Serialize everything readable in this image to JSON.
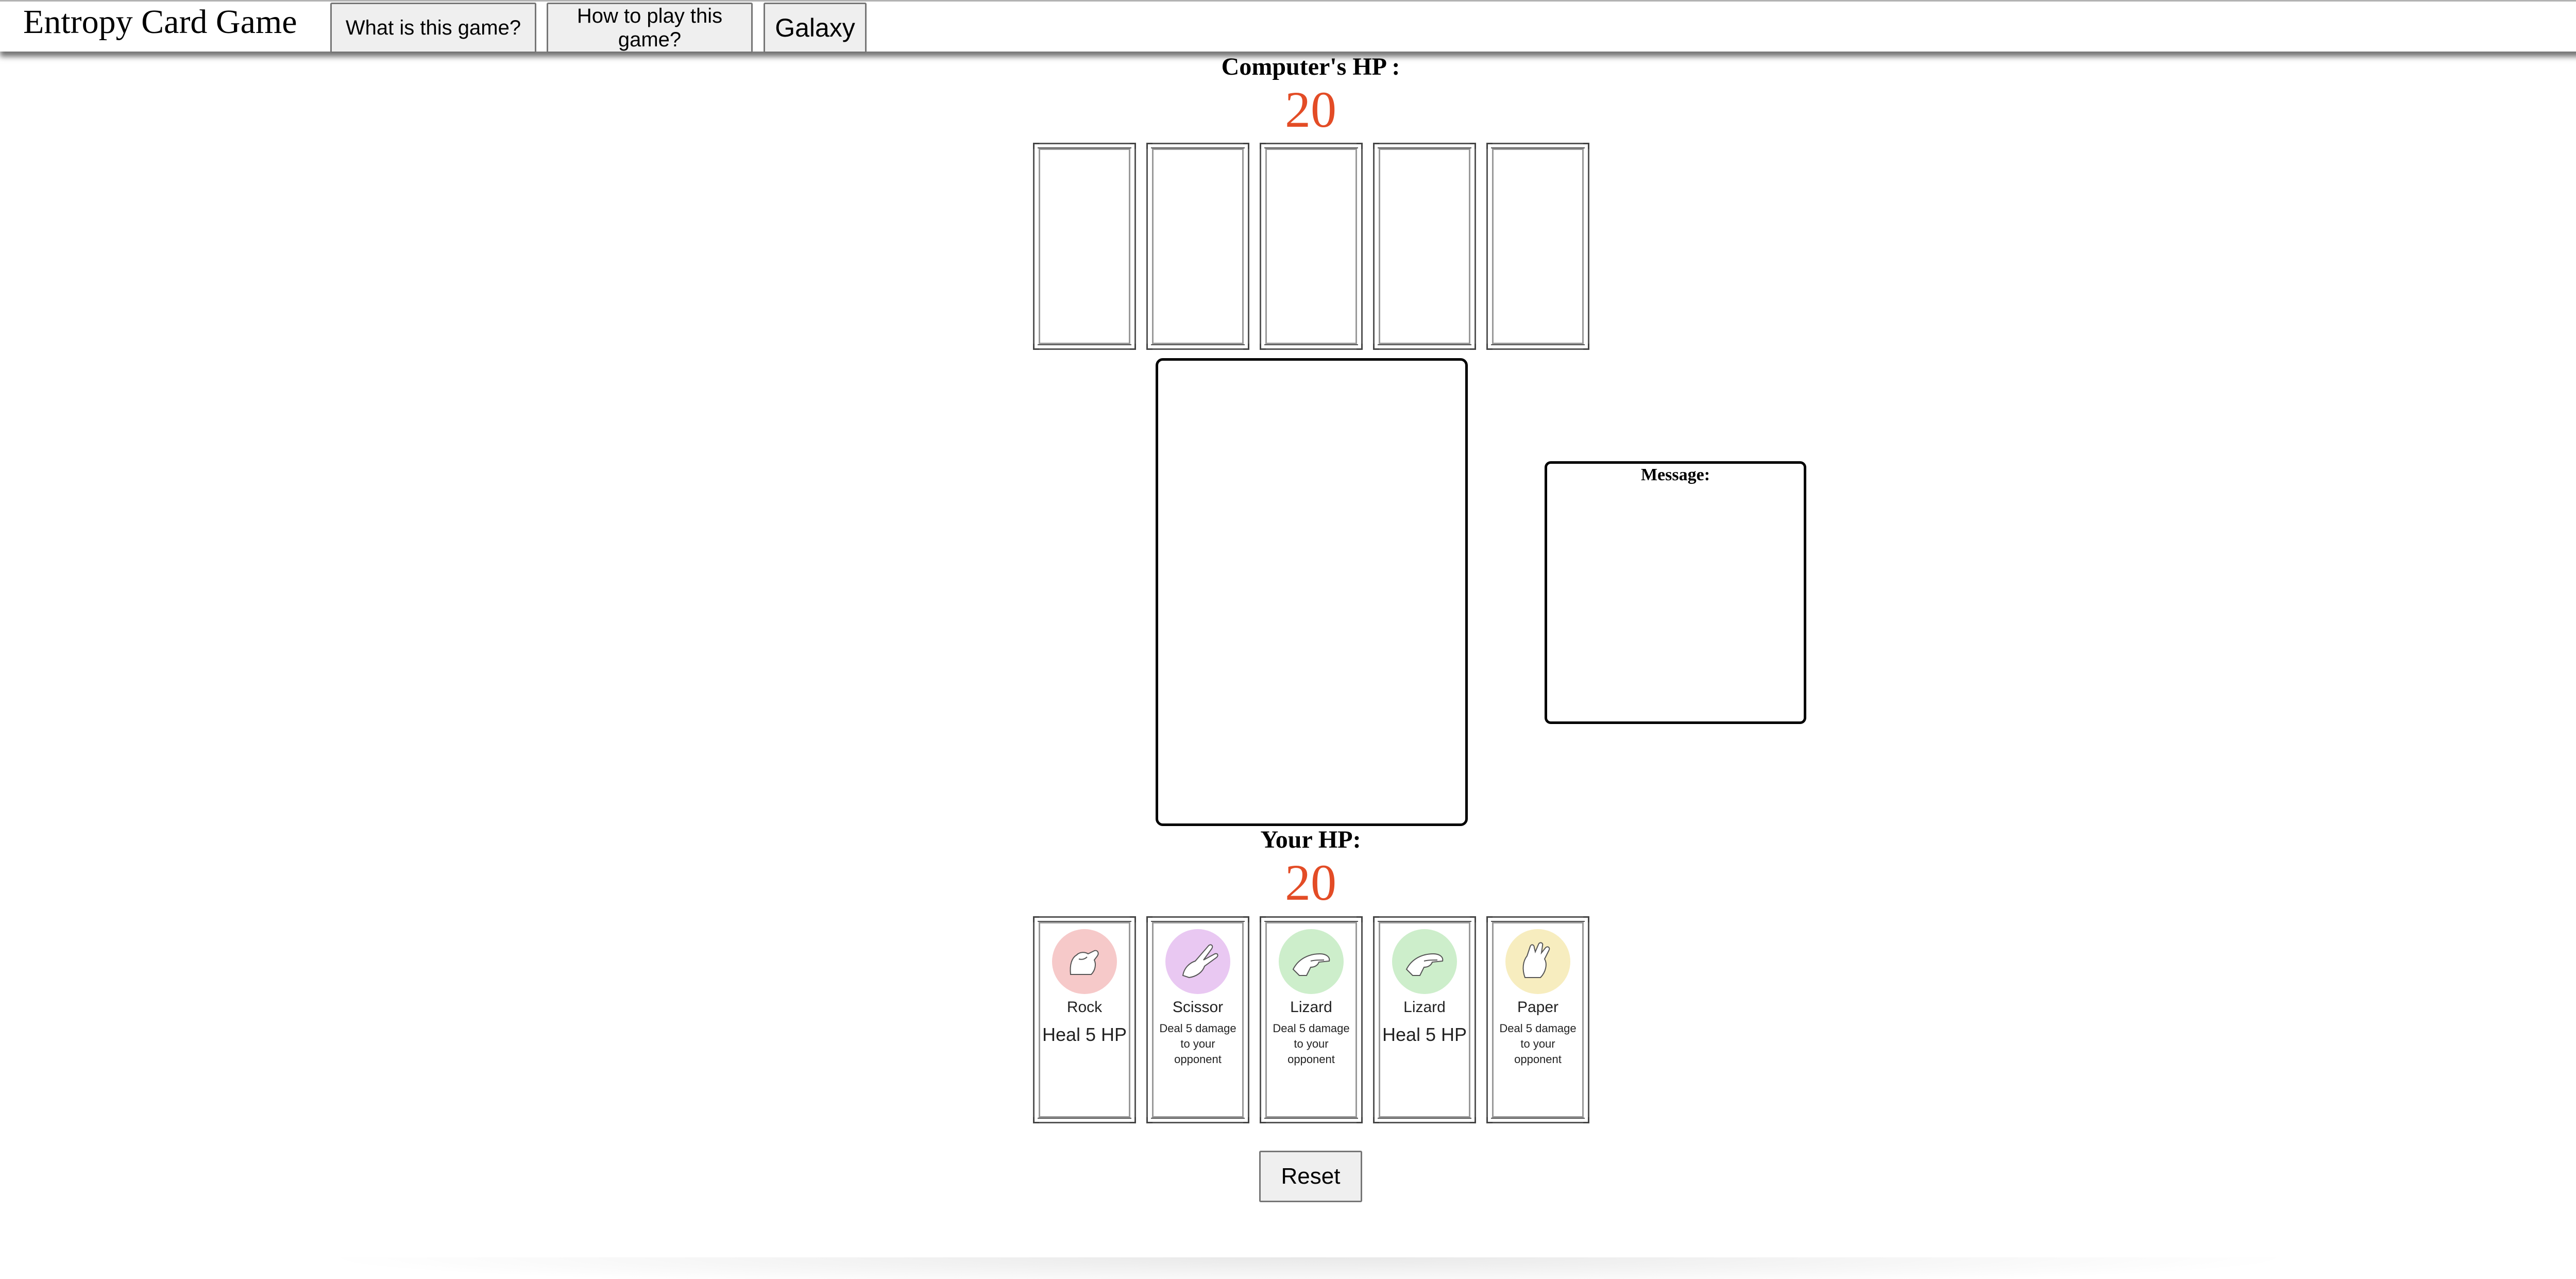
{
  "header": {
    "title": "Entropy Card Game",
    "nav": {
      "what": "What is this game?",
      "how": "How to play this game?",
      "galaxy": "Galaxy"
    }
  },
  "computer": {
    "hp_label": "Computer's HP :",
    "hp": "20",
    "cards_face_down": 5
  },
  "player": {
    "hp_label": "Your HP:",
    "hp": "20",
    "hand": [
      {
        "name": "Rock",
        "effect": "Heal 5 HP",
        "icon": "rock-hand-icon",
        "color": "#f6c9c9"
      },
      {
        "name": "Scissor",
        "effect": "Deal 5 damage to your opponent",
        "icon": "scissor-hand-icon",
        "color": "#e9c8f2"
      },
      {
        "name": "Lizard",
        "effect": "Deal 5 damage to your opponent",
        "icon": "lizard-hand-icon",
        "color": "#cdeecb"
      },
      {
        "name": "Lizard",
        "effect": "Heal 5 HP",
        "icon": "lizard-hand-icon",
        "color": "#cdeecb"
      },
      {
        "name": "Paper",
        "effect": "Deal 5 damage to your opponent",
        "icon": "paper-hand-icon",
        "color": "#f7edbf"
      }
    ]
  },
  "message": {
    "title": "Message:",
    "text": ""
  },
  "controls": {
    "reset_label": "Reset"
  },
  "colors": {
    "hp_value": "#e34c26"
  }
}
